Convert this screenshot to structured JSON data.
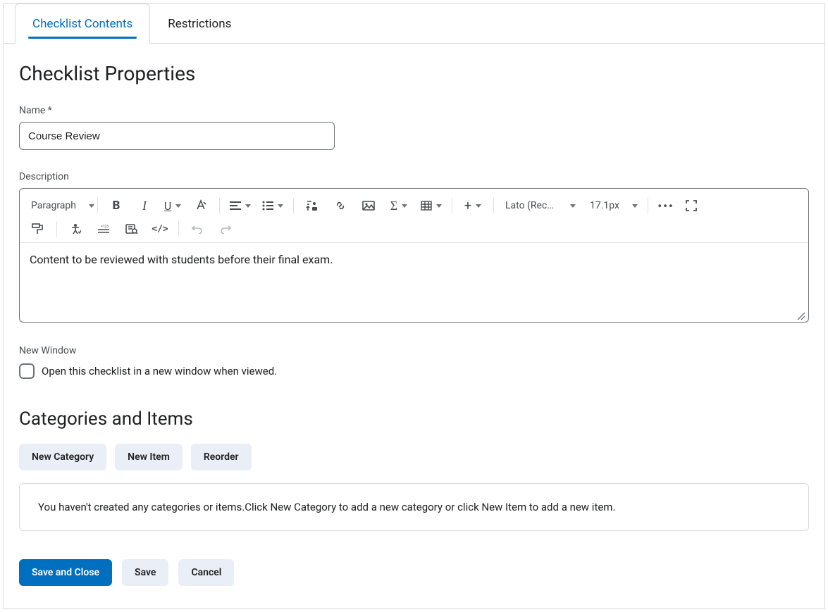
{
  "tabs": {
    "contents": "Checklist Contents",
    "restrictions": "Restrictions"
  },
  "headings": {
    "properties": "Checklist Properties",
    "categories": "Categories and Items"
  },
  "fields": {
    "name_label": "Name *",
    "name_value": "Course Review",
    "description_label": "Description",
    "description_value": "Content to be reviewed with students before their final exam.",
    "new_window_label": "New Window",
    "new_window_text": "Open this checklist in a new window when viewed."
  },
  "editor": {
    "paragraph": "Paragraph",
    "font": "Lato (Recomm…",
    "size": "17.1px"
  },
  "buttons": {
    "new_category": "New Category",
    "new_item": "New Item",
    "reorder": "Reorder",
    "save_close": "Save and Close",
    "save": "Save",
    "cancel": "Cancel"
  },
  "empty_message": "You haven't created any categories or items.Click New Category to add a new category or click New Item to add a new item."
}
